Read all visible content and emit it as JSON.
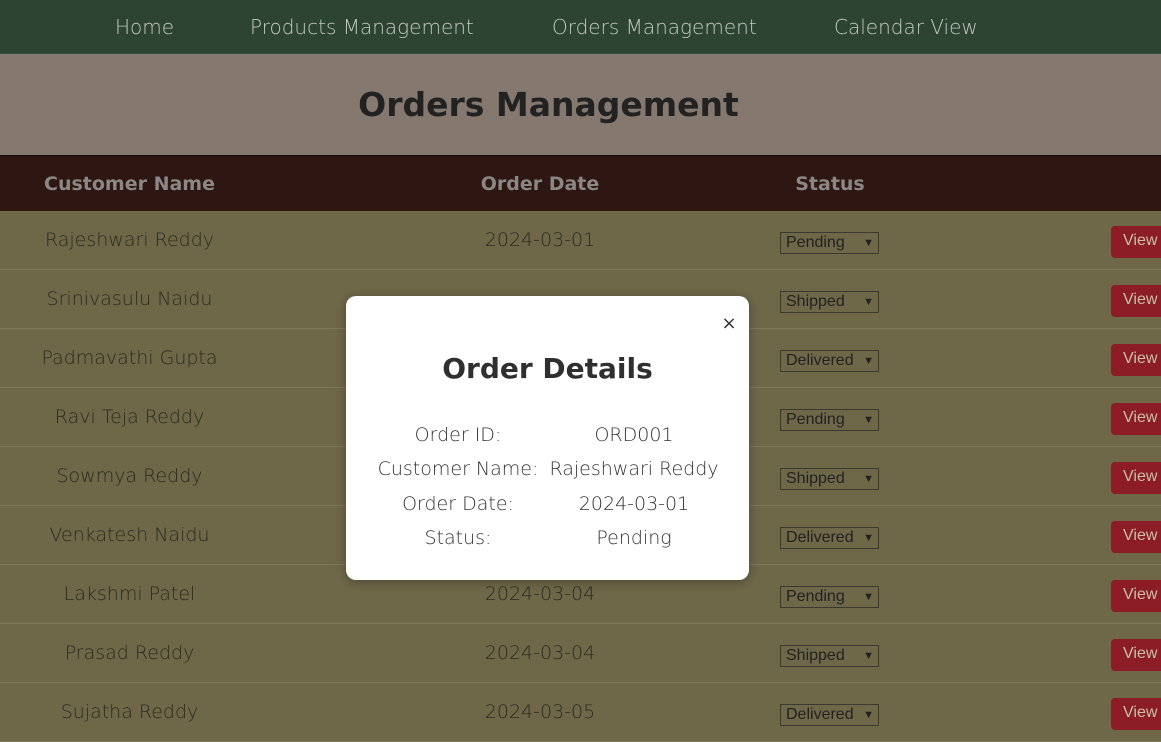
{
  "nav": {
    "items": [
      {
        "label": "Home"
      },
      {
        "label": "Products Management"
      },
      {
        "label": "Orders Management"
      },
      {
        "label": "Calendar View"
      }
    ]
  },
  "header": {
    "title": "Orders Management"
  },
  "table": {
    "columns": [
      "Customer Name",
      "Order Date",
      "Status"
    ],
    "rows": [
      {
        "name": "Rajeshwari Reddy",
        "date": "2024-03-01",
        "status": "Pending",
        "action": "View"
      },
      {
        "name": "Srinivasulu Naidu",
        "date": "",
        "status": "Shipped",
        "action": "View"
      },
      {
        "name": "Padmavathi Gupta",
        "date": "",
        "status": "Delivered",
        "action": "View"
      },
      {
        "name": "Ravi Teja Reddy",
        "date": "",
        "status": "Pending",
        "action": "View"
      },
      {
        "name": "Sowmya Reddy",
        "date": "",
        "status": "Shipped",
        "action": "View"
      },
      {
        "name": "Venkatesh Naidu",
        "date": "",
        "status": "Delivered",
        "action": "View"
      },
      {
        "name": "Lakshmi Patel",
        "date": "2024-03-04",
        "status": "Pending",
        "action": "View"
      },
      {
        "name": "Prasad Reddy",
        "date": "2024-03-04",
        "status": "Shipped",
        "action": "View"
      },
      {
        "name": "Sujatha Reddy",
        "date": "2024-03-05",
        "status": "Delivered",
        "action": "View"
      }
    ]
  },
  "modal": {
    "close_symbol": "×",
    "title": "Order Details",
    "fields": [
      {
        "label": "Order ID:",
        "value": "ORD001"
      },
      {
        "label": "Customer Name:",
        "value": "Rajeshwari Reddy"
      },
      {
        "label": "Order Date:",
        "value": "2024-03-01"
      },
      {
        "label": "Status:",
        "value": "Pending"
      }
    ]
  },
  "colors": {
    "nav_bg": "#2e4432",
    "header_bg": "#85786f",
    "table_head_bg": "#2e1613",
    "row_bg": "#6e6748",
    "view_button_bg": "#8c1c26"
  }
}
